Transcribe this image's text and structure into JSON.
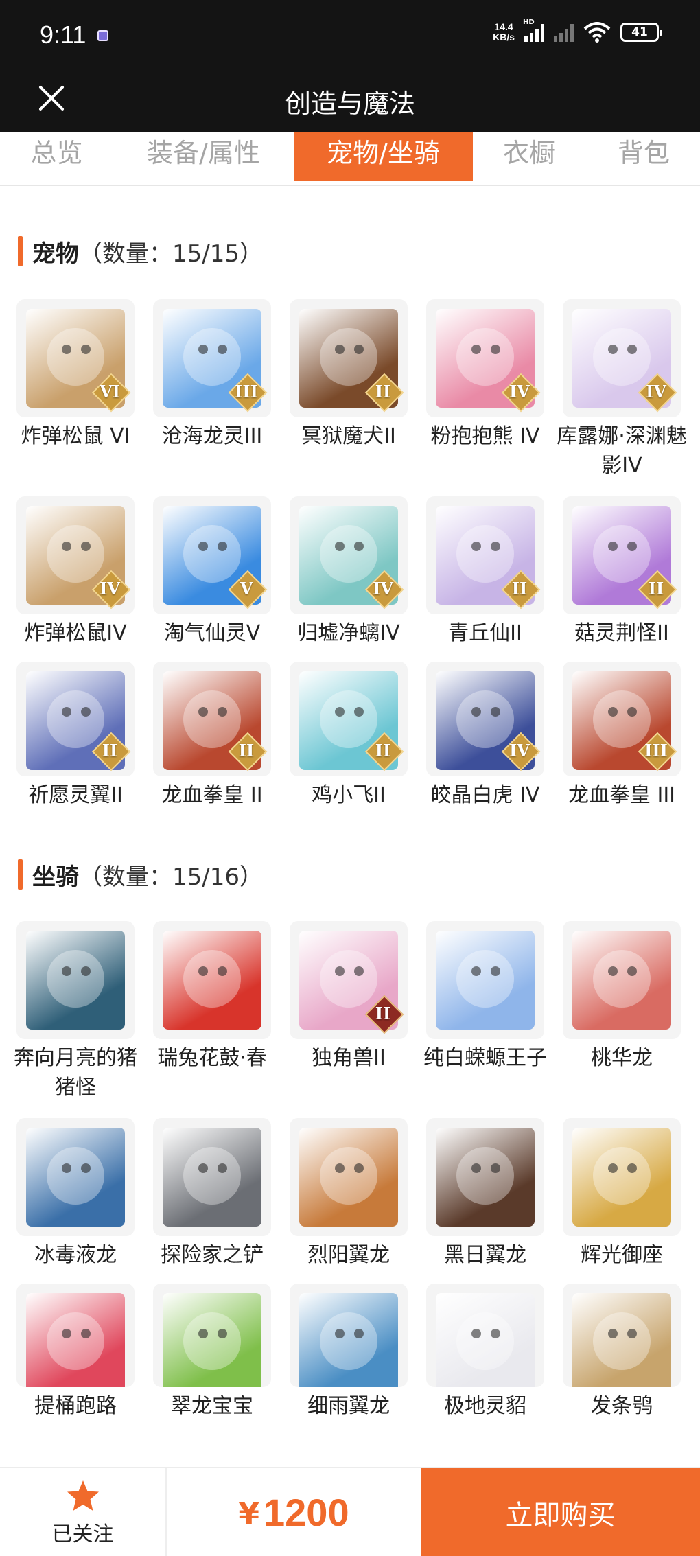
{
  "status_bar": {
    "time": "9:11",
    "net_speed_value": "14.4",
    "net_speed_unit": "KB/s",
    "network_type": "HD",
    "battery": "41"
  },
  "header": {
    "title": "创造与魔法",
    "close_icon": "close-icon"
  },
  "tabs": [
    {
      "label": "总览",
      "active": false
    },
    {
      "label": "装备/属性",
      "active": false
    },
    {
      "label": "宠物/坐骑",
      "active": true
    },
    {
      "label": "衣橱",
      "active": false
    },
    {
      "label": "背包",
      "active": false
    }
  ],
  "pets": {
    "title": "宠物",
    "count": "（数量：15/15）",
    "items": [
      {
        "name": "炸弹松鼠 VI",
        "rank": "VI",
        "color": "#c9a06b"
      },
      {
        "name": "沧海龙灵III",
        "rank": "III",
        "color": "#6aa8e8"
      },
      {
        "name": "冥狱魔犬II",
        "rank": "II",
        "color": "#7a4a2a"
      },
      {
        "name": "粉抱抱熊 IV",
        "rank": "IV",
        "color": "#e98aa6"
      },
      {
        "name": "库露娜·深渊魅影IV",
        "rank": "IV",
        "color": "#d9c8ec"
      },
      {
        "name": "炸弹松鼠IV",
        "rank": "IV",
        "color": "#c9a06b"
      },
      {
        "name": "淘气仙灵V",
        "rank": "V",
        "color": "#3a8be0"
      },
      {
        "name": "归墟净螭IV",
        "rank": "IV",
        "color": "#7ec7c4"
      },
      {
        "name": "青丘仙II",
        "rank": "II",
        "color": "#c7b4e6"
      },
      {
        "name": "菇灵荆怪II",
        "rank": "II",
        "color": "#b07ad8"
      },
      {
        "name": "祈愿灵翼II",
        "rank": "II",
        "color": "#5f6fb8"
      },
      {
        "name": "龙血拳皇 II",
        "rank": "II",
        "color": "#b9482f"
      },
      {
        "name": "鸡小飞II",
        "rank": "II",
        "color": "#6cc6d3"
      },
      {
        "name": "皎晶白虎 IV",
        "rank": "IV",
        "color": "#3d4f9a"
      },
      {
        "name": "龙血拳皇 III",
        "rank": "III",
        "color": "#b9482f"
      }
    ]
  },
  "mounts": {
    "title": "坐骑",
    "count": "（数量：15/16）",
    "items": [
      {
        "name": "奔向月亮的猪猪怪",
        "rank": "",
        "color": "#2f5f78"
      },
      {
        "name": "瑞兔花鼓·春",
        "rank": "",
        "color": "#d8342b"
      },
      {
        "name": "独角兽II",
        "rank": "II",
        "color": "#e8a7c8"
      },
      {
        "name": "纯白蝾螈王子",
        "rank": "",
        "color": "#8fb5ea"
      },
      {
        "name": "桃华龙",
        "rank": "",
        "color": "#d96b62"
      },
      {
        "name": "冰毒液龙",
        "rank": "",
        "color": "#3a6fa8"
      },
      {
        "name": "探险家之铲",
        "rank": "",
        "color": "#6b6e74"
      },
      {
        "name": "烈阳翼龙",
        "rank": "",
        "color": "#c77a3a"
      },
      {
        "name": "黑日翼龙",
        "rank": "",
        "color": "#5a3a2a"
      },
      {
        "name": "辉光御座",
        "rank": "",
        "color": "#d7a944"
      },
      {
        "name": "提桶跑路",
        "rank": "",
        "color": "#e0475c"
      },
      {
        "name": "翠龙宝宝",
        "rank": "",
        "color": "#7fbf4a"
      },
      {
        "name": "细雨翼龙",
        "rank": "",
        "color": "#4a8ec4"
      },
      {
        "name": "极地灵貂",
        "rank": "",
        "color": "#e9e9ee"
      },
      {
        "name": "发条鸮",
        "rank": "",
        "color": "#c7a46c"
      }
    ]
  },
  "bottom": {
    "follow_label": "已关注",
    "currency": "¥",
    "price": "1200",
    "buy_label": "立即购买",
    "accent": "#f06a2b"
  }
}
